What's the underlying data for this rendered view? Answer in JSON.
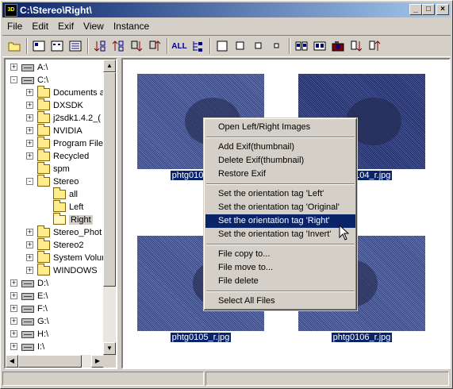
{
  "window": {
    "title": "C:\\Stereo\\Right\\",
    "app_icon_text": "3D",
    "minimize": "_",
    "maximize": "□",
    "close": "×"
  },
  "menubar": [
    "File",
    "Edit",
    "Exif",
    "View",
    "Instance"
  ],
  "toolbar": {
    "all_label": "ALL"
  },
  "tree": [
    {
      "label": "A:\\",
      "kind": "drive",
      "sign": "+",
      "level": 0
    },
    {
      "label": "C:\\",
      "kind": "drive",
      "sign": "-",
      "level": 0
    },
    {
      "label": "Documents a",
      "kind": "folder",
      "sign": "+",
      "level": 1
    },
    {
      "label": "DXSDK",
      "kind": "folder",
      "sign": "+",
      "level": 1
    },
    {
      "label": "j2sdk1.4.2_(",
      "kind": "folder",
      "sign": "+",
      "level": 1
    },
    {
      "label": "NVIDIA",
      "kind": "folder",
      "sign": "+",
      "level": 1
    },
    {
      "label": "Program File",
      "kind": "folder",
      "sign": "+",
      "level": 1
    },
    {
      "label": "Recycled",
      "kind": "folder",
      "sign": "+",
      "level": 1
    },
    {
      "label": "spm",
      "kind": "folder",
      "sign": "",
      "level": 1
    },
    {
      "label": "Stereo",
      "kind": "folder",
      "sign": "-",
      "level": 1
    },
    {
      "label": "all",
      "kind": "folder",
      "sign": "",
      "level": 2
    },
    {
      "label": "Left",
      "kind": "folder",
      "sign": "",
      "level": 2
    },
    {
      "label": "Right",
      "kind": "folder-open",
      "sign": "",
      "level": 2,
      "selected": true
    },
    {
      "label": "Stereo_Phot",
      "kind": "folder",
      "sign": "+",
      "level": 1
    },
    {
      "label": "Stereo2",
      "kind": "folder",
      "sign": "+",
      "level": 1
    },
    {
      "label": "System Volur",
      "kind": "folder",
      "sign": "+",
      "level": 1
    },
    {
      "label": "WINDOWS",
      "kind": "folder",
      "sign": "+",
      "level": 1
    },
    {
      "label": "D:\\",
      "kind": "drive",
      "sign": "+",
      "level": 0
    },
    {
      "label": "E:\\",
      "kind": "drive",
      "sign": "+",
      "level": 0
    },
    {
      "label": "F:\\",
      "kind": "drive",
      "sign": "+",
      "level": 0
    },
    {
      "label": "G:\\",
      "kind": "drive",
      "sign": "+",
      "level": 0
    },
    {
      "label": "H:\\",
      "kind": "drive",
      "sign": "+",
      "level": 0
    },
    {
      "label": "I:\\",
      "kind": "drive",
      "sign": "+",
      "level": 0
    }
  ],
  "thumbnails": [
    {
      "caption": "phtg0103_r.jpg"
    },
    {
      "caption": "phtg0104_r.jpg"
    },
    {
      "caption": "phtg0105_r.jpg"
    },
    {
      "caption": "phtg0106_r.jpg"
    }
  ],
  "context_menu": [
    {
      "label": "Open Left/Right Images"
    },
    {
      "sep": true
    },
    {
      "label": "Add Exif(thumbnail)"
    },
    {
      "label": "Delete Exif(thumbnail)"
    },
    {
      "label": "Restore Exif"
    },
    {
      "sep": true
    },
    {
      "label": "Set the orientation tag 'Left'"
    },
    {
      "label": "Set the orientation tag 'Original'"
    },
    {
      "label": "Set the orientation tag 'Right'",
      "highlighted": true
    },
    {
      "label": "Set the orientation tag 'Invert'"
    },
    {
      "sep": true
    },
    {
      "label": "File copy to..."
    },
    {
      "label": "File move to..."
    },
    {
      "label": "File delete"
    },
    {
      "sep": true
    },
    {
      "label": "Select All Files"
    }
  ],
  "colors": {
    "selection": "#0a246a",
    "face": "#d4d0c8"
  }
}
